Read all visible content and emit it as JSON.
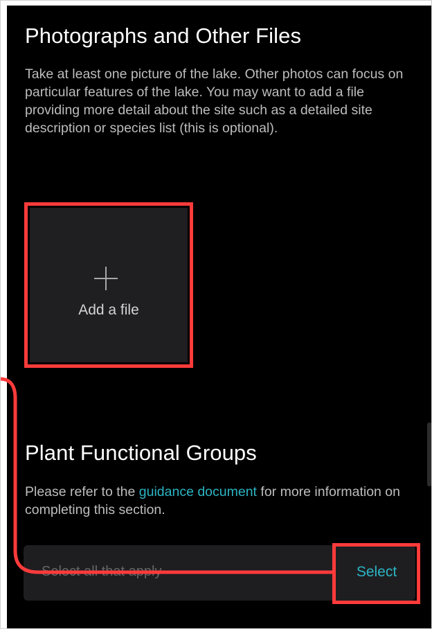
{
  "photos_section": {
    "title": "Photographs and Other Files",
    "description": "Take at least one picture of the lake. Other photos can focus on particular features of the lake. You may want to add a file providing more detail about the site such as a detailed site description or species list (this is optional).",
    "add_file_label": "Add a file"
  },
  "plant_section": {
    "title": "Plant Functional Groups",
    "description_before": "Please refer to the ",
    "link_text": "guidance document",
    "description_after": " for more information on completing this section.",
    "select_placeholder": "Select all that apply",
    "select_button_label": "Select"
  },
  "colors": {
    "background": "#000000",
    "accent": "#2bb5c4",
    "highlight": "#ff3b3b",
    "tile": "#1f1f22"
  },
  "icons": {
    "add_file": "plus-icon"
  }
}
